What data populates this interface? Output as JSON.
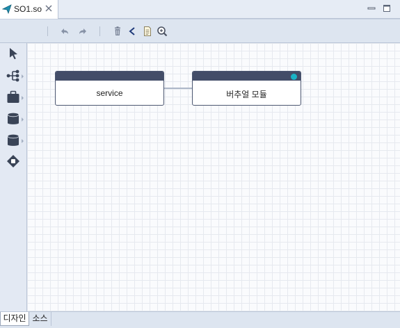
{
  "editor_tab": {
    "title": "SO1.so"
  },
  "toolbar": {
    "buttons": [
      "undo-icon",
      "redo-icon",
      "delete-icon",
      "share-icon",
      "document-icon",
      "search-document-icon"
    ]
  },
  "palette": {
    "tools": [
      "select-arrow-icon",
      "hierarchy-icon",
      "package-icon",
      "database-icon",
      "database-icon",
      "gateway-icon"
    ]
  },
  "diagram": {
    "nodes": [
      {
        "label": "service"
      },
      {
        "label": "버추얼 모듈",
        "status_color": "#1ab3c6"
      }
    ]
  },
  "bottom_tabs": [
    {
      "label": "디자인",
      "active": true
    },
    {
      "label": "소스",
      "active": false
    }
  ],
  "colors": {
    "node_header": "#434d68",
    "status_dot": "#1ab3c6",
    "toolbar_icon": "#8792a6",
    "accent_icon": "#1f3a7a"
  }
}
